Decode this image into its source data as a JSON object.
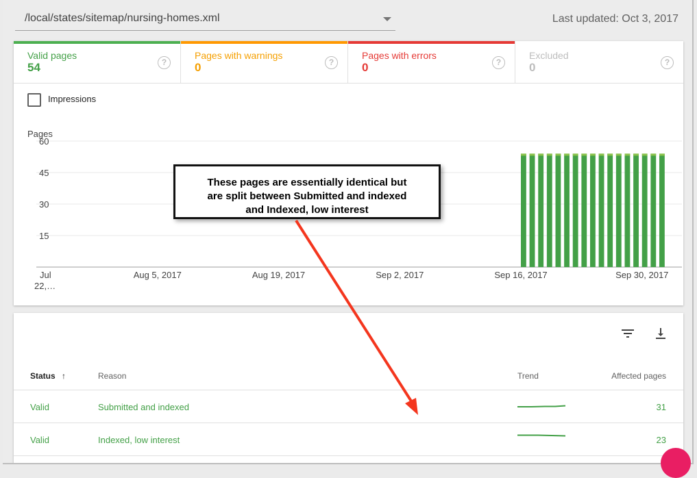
{
  "header": {
    "sitemap_path": "/local/states/sitemap/nursing-homes.xml",
    "last_updated": "Last updated: Oct 3, 2017"
  },
  "tabs": [
    {
      "label": "Valid pages",
      "count": "54",
      "color": "#43a047",
      "bar": "#4caf50"
    },
    {
      "label": "Pages with warnings",
      "count": "0",
      "color": "#f59f00",
      "bar": "#ff9800"
    },
    {
      "label": "Pages with errors",
      "count": "0",
      "color": "#e53935",
      "bar": "#e53935"
    },
    {
      "label": "Excluded",
      "count": "0",
      "color": "#bdbdbd",
      "bar": "#ffffff"
    }
  ],
  "impressions_label": "Impressions",
  "chart_data": {
    "type": "bar",
    "ylabel": "Pages",
    "yticks": [
      15,
      30,
      45,
      60
    ],
    "ylim": [
      0,
      60
    ],
    "x_labels": [
      {
        "text": "Jul 22,…",
        "date": "2017-07-22"
      },
      {
        "text": "Aug 5, 2017",
        "date": "2017-08-05"
      },
      {
        "text": "Aug 19, 2017",
        "date": "2017-08-19"
      },
      {
        "text": "Sep 2, 2017",
        "date": "2017-09-02"
      },
      {
        "text": "Sep 16, 2017",
        "date": "2017-09-16"
      },
      {
        "text": "Sep 30, 2017",
        "date": "2017-09-30"
      }
    ],
    "x_start": "2017-07-22",
    "x_end": "2017-10-02",
    "series": [
      {
        "color": "#43a047",
        "points": [
          {
            "date": "2017-09-16",
            "value": 54
          },
          {
            "date": "2017-09-17",
            "value": 54
          },
          {
            "date": "2017-09-18",
            "value": 54
          },
          {
            "date": "2017-09-19",
            "value": 54
          },
          {
            "date": "2017-09-20",
            "value": 54
          },
          {
            "date": "2017-09-21",
            "value": 54
          },
          {
            "date": "2017-09-22",
            "value": 54
          },
          {
            "date": "2017-09-23",
            "value": 54
          },
          {
            "date": "2017-09-24",
            "value": 54
          },
          {
            "date": "2017-09-25",
            "value": 54
          },
          {
            "date": "2017-09-26",
            "value": 54
          },
          {
            "date": "2017-09-27",
            "value": 54
          },
          {
            "date": "2017-09-28",
            "value": 54
          },
          {
            "date": "2017-09-29",
            "value": 54
          },
          {
            "date": "2017-09-30",
            "value": 54
          },
          {
            "date": "2017-10-01",
            "value": 54
          },
          {
            "date": "2017-10-02",
            "value": 54
          }
        ]
      }
    ]
  },
  "callout": {
    "lines": [
      "These pages are essentially identical but",
      "are split between Submitted and indexed",
      "and Indexed, low interest"
    ],
    "arrow_color": "#f4361e"
  },
  "table": {
    "filter_icon": "filter-icon",
    "download_icon": "download-icon",
    "headers": {
      "status": "Status",
      "reason": "Reason",
      "trend": "Trend",
      "affected": "Affected pages"
    },
    "rows": [
      {
        "status": "Valid",
        "reason": "Submitted and indexed",
        "affected": "31"
      },
      {
        "status": "Valid",
        "reason": "Indexed, low interest",
        "affected": "23"
      }
    ]
  }
}
